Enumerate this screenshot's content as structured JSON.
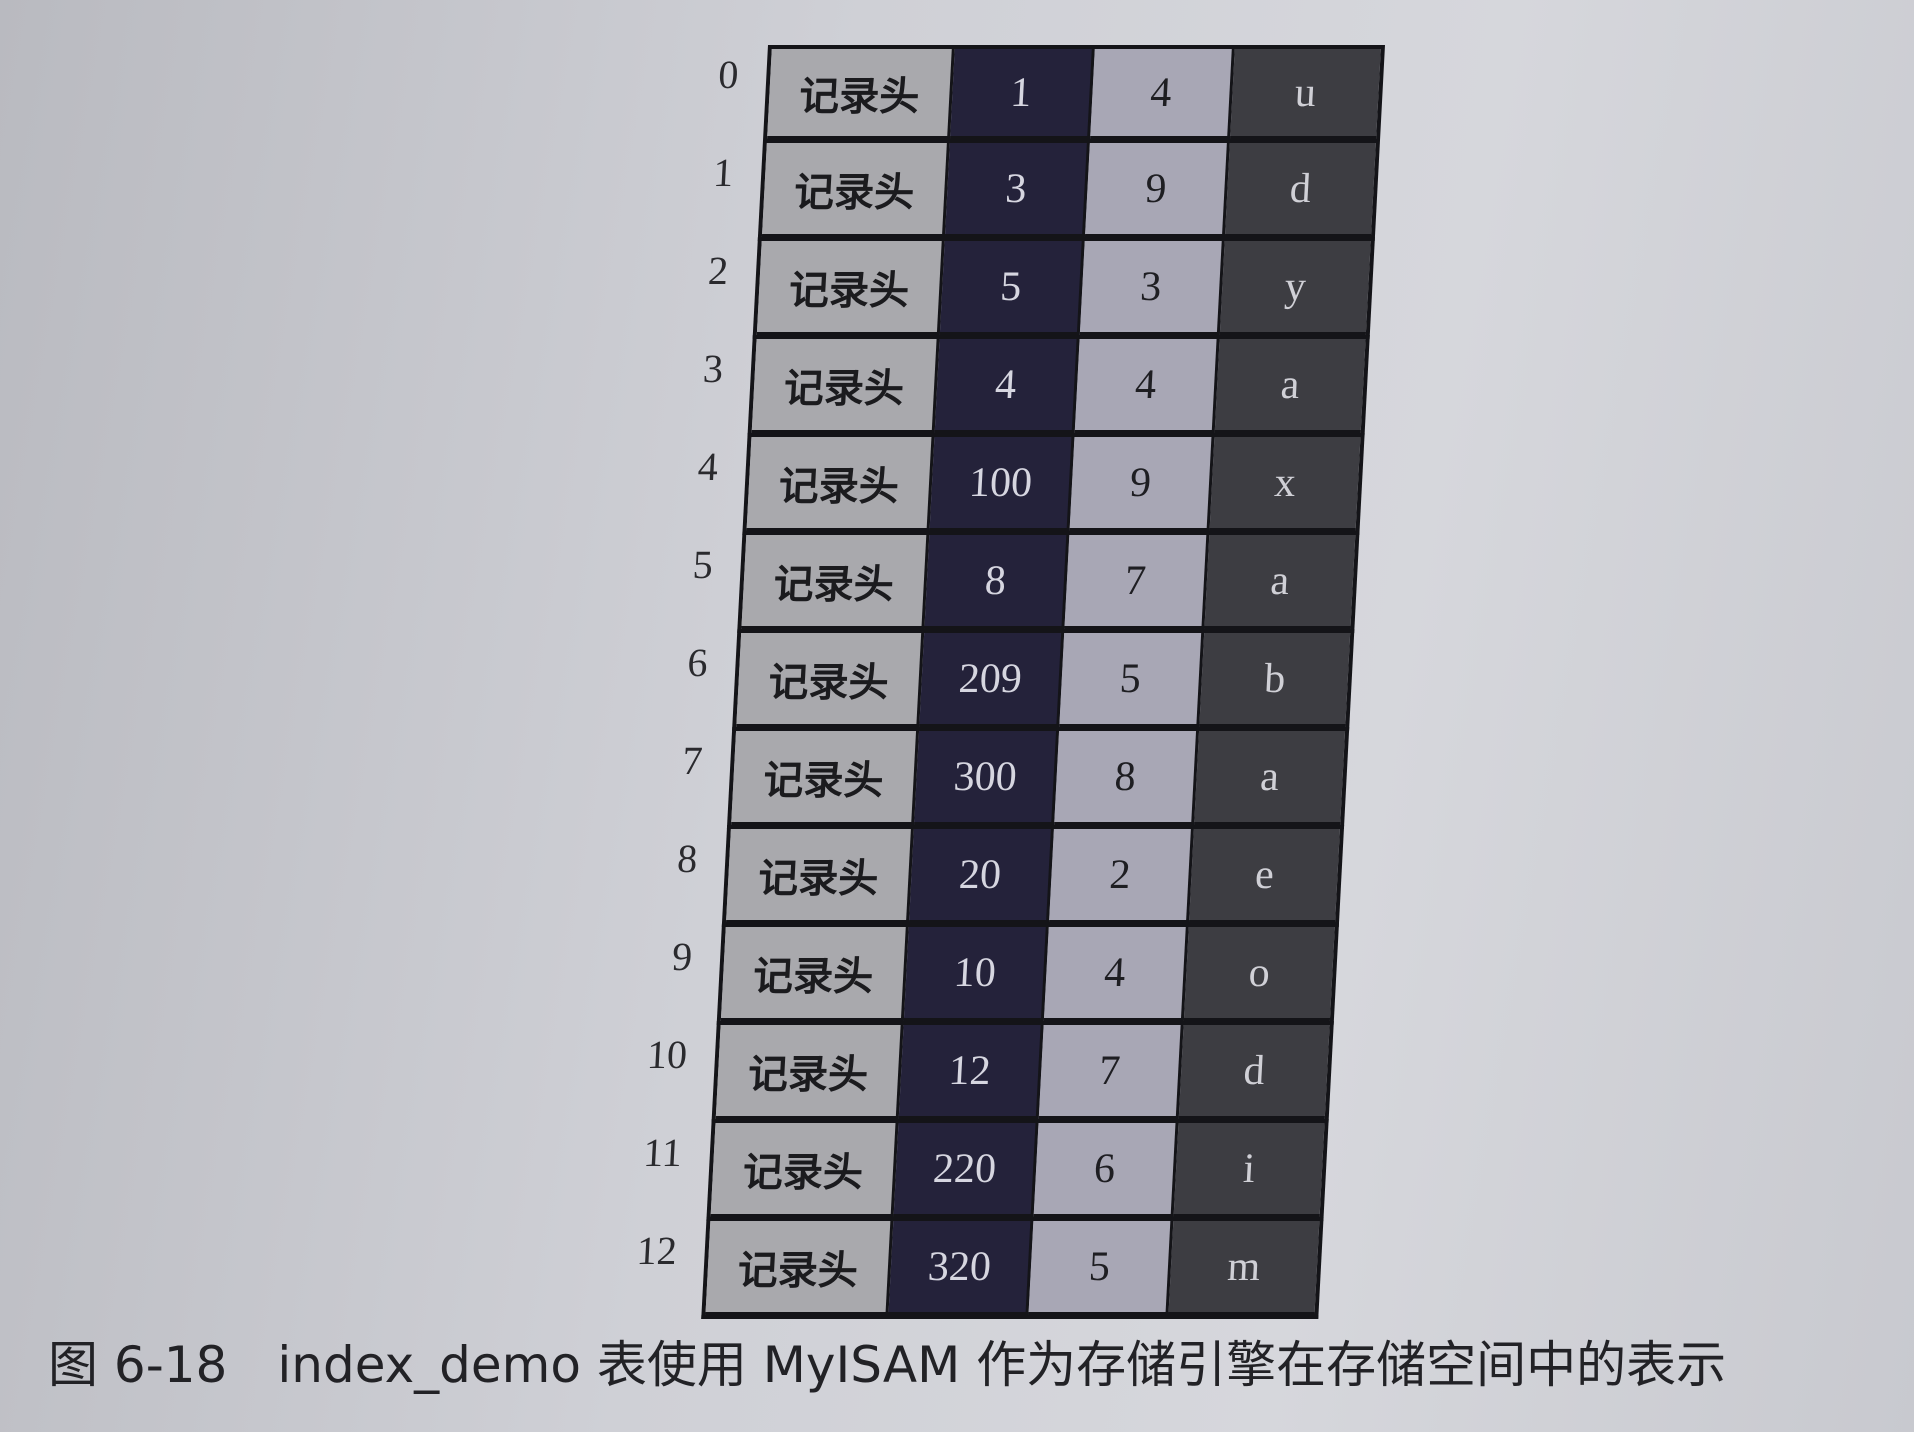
{
  "figure": {
    "rows": [
      {
        "index": "0",
        "header": "记录头",
        "c1": "1",
        "c2": "4",
        "c3": "u"
      },
      {
        "index": "1",
        "header": "记录头",
        "c1": "3",
        "c2": "9",
        "c3": "d"
      },
      {
        "index": "2",
        "header": "记录头",
        "c1": "5",
        "c2": "3",
        "c3": "y"
      },
      {
        "index": "3",
        "header": "记录头",
        "c1": "4",
        "c2": "4",
        "c3": "a"
      },
      {
        "index": "4",
        "header": "记录头",
        "c1": "100",
        "c2": "9",
        "c3": "x"
      },
      {
        "index": "5",
        "header": "记录头",
        "c1": "8",
        "c2": "7",
        "c3": "a"
      },
      {
        "index": "6",
        "header": "记录头",
        "c1": "209",
        "c2": "5",
        "c3": "b"
      },
      {
        "index": "7",
        "header": "记录头",
        "c1": "300",
        "c2": "8",
        "c3": "a"
      },
      {
        "index": "8",
        "header": "记录头",
        "c1": "20",
        "c2": "2",
        "c3": "e"
      },
      {
        "index": "9",
        "header": "记录头",
        "c1": "10",
        "c2": "4",
        "c3": "o"
      },
      {
        "index": "10",
        "header": "记录头",
        "c1": "12",
        "c2": "7",
        "c3": "d"
      },
      {
        "index": "11",
        "header": "记录头",
        "c1": "220",
        "c2": "6",
        "c3": "i"
      },
      {
        "index": "12",
        "header": "记录头",
        "c1": "320",
        "c2": "5",
        "c3": "m"
      }
    ],
    "colors": {
      "header": "#a9a9ad",
      "col1": "#24223a",
      "col2": "#a8a7b5",
      "col3": "#3d3d42"
    }
  },
  "caption": {
    "number": "图 6-18",
    "text": "index_demo 表使用 MyISAM 作为存储引擎在存储空间中的表示"
  }
}
